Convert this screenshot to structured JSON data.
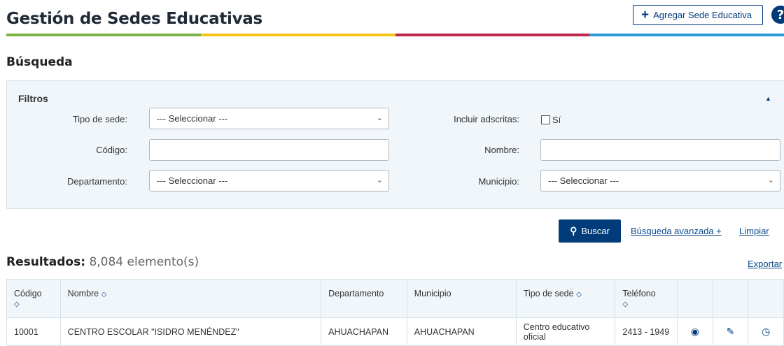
{
  "header": {
    "title": "Gestión de Sedes Educativas",
    "add_button_label": "Agregar Sede Educativa",
    "help_icon": "?"
  },
  "colors": {
    "bar": [
      "#7cb342",
      "#f5c518",
      "#c0274e",
      "#2d9cd7"
    ],
    "primary": "#003b7a"
  },
  "search": {
    "section_title": "Búsqueda",
    "filters_title": "Filtros",
    "fields": {
      "tipo_sede": {
        "label": "Tipo de sede:",
        "value": "--- Seleccionar ---"
      },
      "incluir_adscritas": {
        "label": "Incluir adscritas:",
        "option": "Sí",
        "checked": false
      },
      "codigo": {
        "label": "Código:",
        "value": ""
      },
      "nombre": {
        "label": "Nombre:",
        "value": ""
      },
      "departamento": {
        "label": "Departamento:",
        "value": "--- Seleccionar ---"
      },
      "municipio": {
        "label": "Municipio:",
        "value": "--- Seleccionar ---"
      }
    },
    "search_button": "Buscar",
    "advanced_link": "Búsqueda avanzada +",
    "clear_link": "Limpiar"
  },
  "results": {
    "label": "Resultados:",
    "count": "8,084 elemento(s)",
    "export_link": "Exportar",
    "columns": [
      "Código",
      "Nombre",
      "Departamento",
      "Municipio",
      "Tipo de sede",
      "Teléfono"
    ],
    "rows": [
      {
        "codigo": "10001",
        "nombre": "CENTRO ESCOLAR \"ISIDRO MENÉNDEZ\"",
        "departamento": "AHUACHAPAN",
        "municipio": "AHUACHAPAN",
        "tipo": "Centro educativo oficial",
        "telefono": "2413 - 1949"
      }
    ]
  }
}
